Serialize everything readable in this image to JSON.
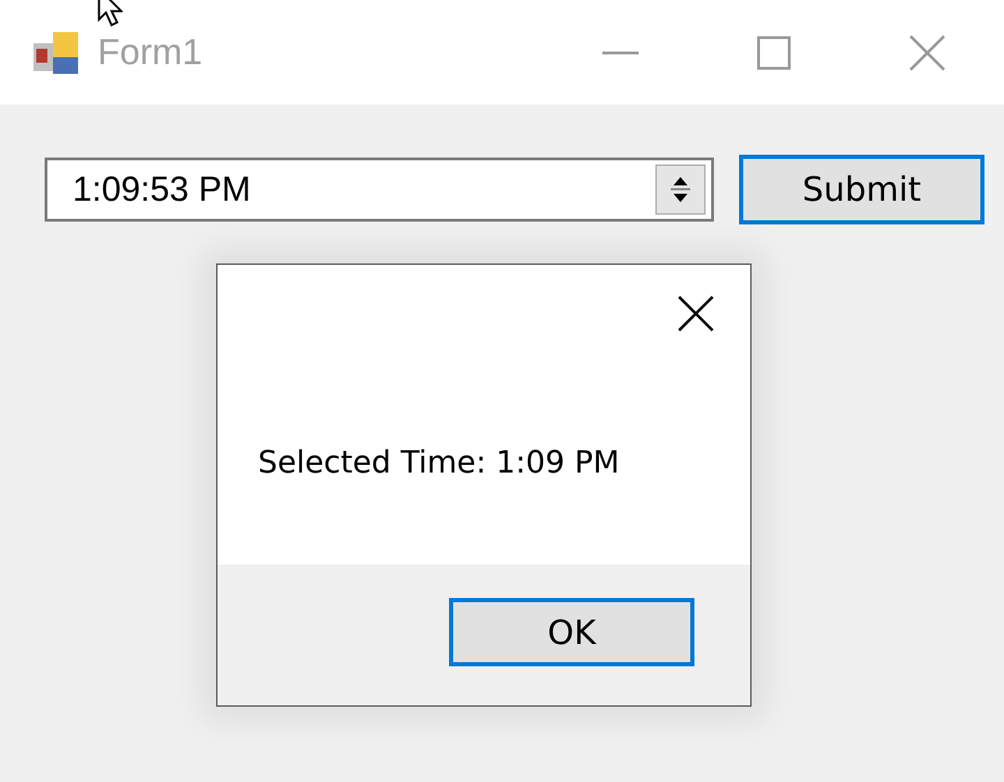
{
  "window": {
    "title": "Form1",
    "active": false
  },
  "time_picker": {
    "value": "1:09:53 PM"
  },
  "submit_button": {
    "label": "Submit",
    "focused": true
  },
  "dialog": {
    "message": "Selected Time: 1:09 PM",
    "ok_button": {
      "label": "OK",
      "focused": true
    }
  }
}
